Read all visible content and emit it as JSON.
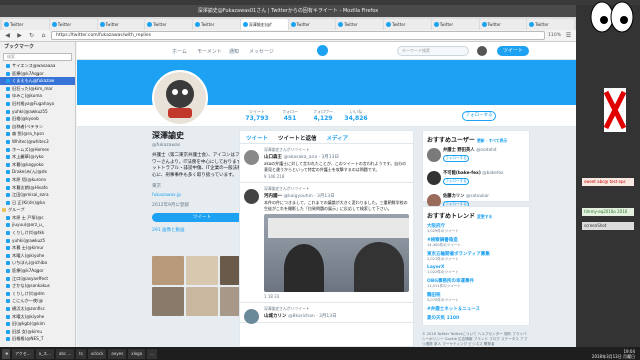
{
  "window": {
    "title": "深澤諭史@Fukazawas01さん | Twitterからの固有キヲイート - Mozilla Firefox"
  },
  "tabs": [
    {
      "label": "Twitter"
    },
    {
      "label": "Twitter"
    },
    {
      "label": "Twitter"
    },
    {
      "label": "Twitter"
    },
    {
      "label": "Twitter"
    },
    {
      "label": "深澤諭史(@f"
    },
    {
      "label": "Twitter"
    },
    {
      "label": "Twitter"
    },
    {
      "label": "Twitter"
    },
    {
      "label": "Twitter"
    },
    {
      "label": "Twitter"
    },
    {
      "label": "Twitter"
    }
  ],
  "navbar": {
    "url": "https://twitter.com/fukazawas/with_replies",
    "zoom": "110%"
  },
  "sidebar": {
    "title": "ブックマーク",
    "search_placeholder": "検索",
    "items": [
      {
        "label": "サイエンス@wasaaaa",
        "type": "item"
      },
      {
        "label": "医療(@k7Aqgor",
        "type": "item"
      },
      {
        "label": "くまえもん@fukazaw",
        "type": "selected"
      },
      {
        "label": "旧狂った(@kim_mar",
        "type": "item"
      },
      {
        "label": "ゆみこ(@kuma",
        "type": "item"
      },
      {
        "label": "旧村格ya@Fugahaya",
        "type": "item"
      },
      {
        "label": "yuhki(@awkuz55",
        "type": "item"
      },
      {
        "label": "旧格(@kyonb",
        "type": "item"
      },
      {
        "label": "自称者(ベテラン",
        "type": "item"
      },
      {
        "label": "森 悦(@ra_hpsn",
        "type": "item"
      },
      {
        "label": "Whitec(@whitec3",
        "type": "item"
      },
      {
        "label": "ホームズ(@Homes",
        "type": "item"
      },
      {
        "label": "木上麗華(@ryko",
        "type": "item"
      },
      {
        "label": "木暮(@kogyoko",
        "type": "item"
      },
      {
        "label": "Drake(み(ん)@dx",
        "type": "item"
      },
      {
        "label": "木原 悟(@kuronn",
        "type": "item"
      },
      {
        "label": "木暮志朗(@Hisafo",
        "type": "item"
      },
      {
        "label": "江田(@misai_ezra",
        "type": "item"
      },
      {
        "label": "日 正(Ki(dn)@ka",
        "type": "item"
      },
      {
        "label": "グループ",
        "type": "folder"
      },
      {
        "label": "木原 士 戸塚(@c",
        "type": "item"
      },
      {
        "label": "jiuyuu(@orz_u_",
        "type": "item"
      },
      {
        "label": "くりしけ(t)@tkk",
        "type": "item"
      },
      {
        "label": "yuhki(@awkuz5",
        "type": "item"
      },
      {
        "label": "木暮 士(@kimur",
        "type": "item"
      },
      {
        "label": "木曜人(@kiyohe",
        "type": "item"
      },
      {
        "label": "いちぼん(@ichiba",
        "type": "item"
      },
      {
        "label": "医療(@k7Aqgor",
        "type": "item"
      },
      {
        "label": "江口(@asyaeffect",
        "type": "item"
      },
      {
        "label": "さかな(@sankakus",
        "type": "item"
      },
      {
        "label": "くりしけ(t)@dm",
        "type": "item"
      },
      {
        "label": "こにんか一夜(@",
        "type": "item"
      },
      {
        "label": "横浜太(@zonfisc",
        "type": "item"
      },
      {
        "label": "木曜太(@kiyohe",
        "type": "item"
      },
      {
        "label": "旧(@kgb)(@kim",
        "type": "item"
      },
      {
        "label": "旧部 女(@kimu",
        "type": "item"
      },
      {
        "label": "旧格格(@NES_T",
        "type": "item"
      }
    ]
  },
  "twitter_nav": {
    "home": "ホーム",
    "moments": "モーメント",
    "notifications": "通知",
    "messages": "メッセージ",
    "search_placeholder": "キーワード検索",
    "tweet_button": "ツイート"
  },
  "stats": [
    {
      "label": "ツイート",
      "value": "73,793"
    },
    {
      "label": "フォロー",
      "value": "451"
    },
    {
      "label": "フォロワー",
      "value": "4,129"
    },
    {
      "label": "いいね",
      "value": "34,826"
    }
  ],
  "follow_button": "フォローする",
  "profile": {
    "name": "深澤諭史",
    "handle": "@fukazawas",
    "bio": "弁護士（第二東京弁護士会）、アイコンはフォロワーさんより。IT法務を中心にしております。ネットトラブル・誹謗中傷、IT企業の一般法務を中心に、刑事事件も多く取り扱っています。",
    "location": "東京",
    "link": "fukazawas.jp",
    "joined": "2012年9月に登録",
    "tweet_button": "ツイート",
    "media_label": "291 画像と動画"
  },
  "timeline": {
    "tabs": [
      "ツイート",
      "ツイートと返信",
      "メディア"
    ],
    "tweets": [
      {
        "rt": "深澤諭史さんがリツイート",
        "who": "山口森王",
        "handle": "@akasaka_ana · 3月13日",
        "text": "akaの弁護士に対して言われたことが、このツイートの言われようです。自分の意見と違うからといって特定の弁護士を攻撃するのは問題です。",
        "actions": "9   146   218"
      },
      {
        "rt": "深澤諭史さんがリツイート",
        "who": "河内國一",
        "handle": "@kaigyouhin · 3月13日",
        "text": "本件の件につきまして、これまでの議論が大きく変わりました。三重朝鮮学校の生徒がこれを撮影した「拉致問題の展示」に反応して検索して下さい。",
        "actions": "1   18   33"
      },
      {
        "rt": "深澤諭史さんがリツイート",
        "who": "山城カリン",
        "handle": "@8karichan · 3月13日",
        "text": "",
        "actions": ""
      }
    ]
  },
  "who_to_follow": {
    "title": "おすすめユーザー",
    "sub": "更新 · すべて表示",
    "users": [
      {
        "name": "弁護士 野田英人",
        "handle": "@nodahd",
        "button": "フォローする"
      },
      {
        "name": "不可能(bake-fex)",
        "handle": "@bakefex",
        "button": "フォローする"
      },
      {
        "name": "佐藤カリン",
        "handle": "@satoukar",
        "button": "フォローする"
      }
    ]
  },
  "trends": {
    "title": "おすすめトレンド",
    "sub": "変更する",
    "items": [
      {
        "topic": "大阪府庁",
        "count": "1,029件のツイート"
      },
      {
        "topic": "#検察調書偽造",
        "count": "14,400件のツイート"
      },
      {
        "topic": "東京五輪開催ボランティア募集",
        "count": "2,021件のツイート"
      },
      {
        "topic": "LayerX",
        "count": "1,022件のツイート"
      },
      {
        "topic": "OBG事務所の幸運事件",
        "count": "11,011件のツイート"
      },
      {
        "topic": "鶴田税",
        "count": "5,070件のツイート"
      },
      {
        "topic": "#弁護士ネット＆ニュース",
        "count": ""
      },
      {
        "topic": "夏の天気 1100"
      }
    ]
  },
  "footer": "© 2018 Twitter  Twitterについて  ヘルプセンター  規約  プライバシーポリシー  Cookie  広告情報  ブランド  ブログ  ステータス  アプリ連携  求人  マーケティング  ビジネス  開発者",
  "taskbar": {
    "items": [
      "アクセ...",
      "a_ス...",
      "abc ...",
      "ts",
      "xclock",
      "aeyes",
      "xlogo",
      "..."
    ],
    "clock_time": "19:04",
    "clock_date": "2018年3月13日 月曜日"
  },
  "right_panel": {
    "items": [
      "sweet abc@ test eps",
      "timmy-eq2018o 2016",
      "screenShot"
    ]
  },
  "colors": {
    "twitter_blue": "#1da1f2",
    "selected_bookmark": "#3874d8",
    "window_title": "#4a4a4a"
  }
}
